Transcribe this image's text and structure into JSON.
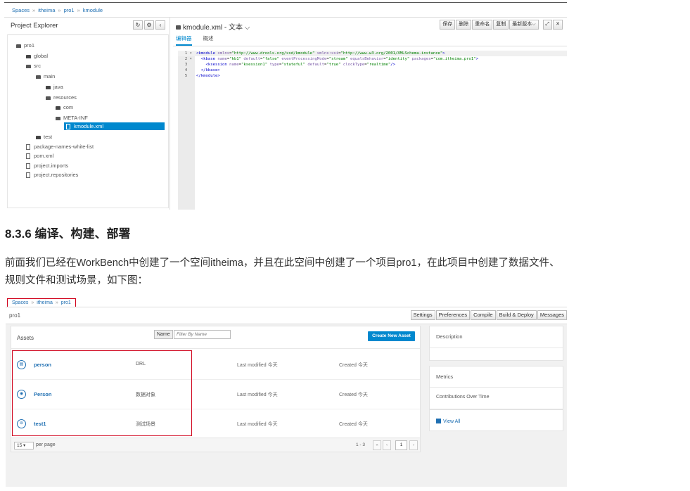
{
  "shot1": {
    "breadcrumb": [
      "Spaces",
      "itheima",
      "pro1",
      "kmodule"
    ],
    "explorer": {
      "title": "Project Explorer",
      "tree": [
        "pro1",
        "global",
        "src",
        "main",
        "java",
        "resources",
        "com",
        "META-INF",
        "kmodule.xml",
        "test",
        "package-names-white-list",
        "pom.xml",
        "project.imports",
        "project.repositories"
      ]
    },
    "editor": {
      "title": "kmodule.xml - 文本",
      "title_suffix": "⌵",
      "actions": [
        "保存",
        "删除",
        "重命名",
        "复制",
        "最新版本⌵"
      ],
      "tabs": [
        "编辑器",
        "概述"
      ],
      "code_lines": [
        {
          "num": "1",
          "fold": "▾",
          "text": "<kmodule xmlns=\"http://www.drools.org/xsd/kmodule\" xmlns:xsi=\"http://www.w3.org/2001/XMLSchema-instance\">"
        },
        {
          "num": "2",
          "fold": "▾",
          "text": "  <kbase name=\"kb1\" default=\"false\" eventProcessingMode=\"stream\" equalsBehavior=\"identity\" packages=\"com.itheima.pro1\">"
        },
        {
          "num": "3",
          "fold": "",
          "text": "    <ksession name=\"ksession1\" type=\"stateful\" default=\"true\" clockType=\"realtime\"/>"
        },
        {
          "num": "4",
          "fold": "",
          "text": "  </kbase>"
        },
        {
          "num": "5",
          "fold": "",
          "text": "</kmodule>"
        }
      ]
    }
  },
  "article": {
    "heading": "8.3.6 编译、构建、部署",
    "paragraph": "前面我们已经在WorkBench中创建了一个空间itheima，并且在此空间中创建了一个项目pro1，在此项目中创建了数据文件、规则文件和测试场景，如下图："
  },
  "shot2": {
    "breadcrumb": [
      "Spaces",
      "itheima",
      "pro1"
    ],
    "project_name": "pro1",
    "project_buttons": [
      "Settings",
      "Preferences",
      "Compile",
      "Build & Deploy",
      "Messages"
    ],
    "assets": {
      "title": "Assets",
      "filter_label": "Name",
      "filter_placeholder": "Filter By Name",
      "create_button": "Create New Asset",
      "rows": [
        {
          "icon": "drl",
          "name": "person",
          "type": "DRL",
          "modified": "Last modified 今天",
          "created": "Created 今天"
        },
        {
          "icon": "data",
          "name": "Person",
          "type": "数据对象",
          "modified": "Last modified 今天",
          "created": "Created 今天"
        },
        {
          "icon": "test",
          "name": "test1",
          "type": "测试场景",
          "modified": "Last modified 今天",
          "created": "Created 今天"
        }
      ],
      "per_page_value": "15",
      "per_page_label": "per page",
      "range": "1 - 3",
      "page": "1"
    },
    "side": {
      "description_title": "Description",
      "metrics_title": "Metrics",
      "contributions_title": "Contributions Over Time",
      "view_all": "View All"
    }
  },
  "colors": {
    "accent": "#0088ce",
    "link": "#1f6fb2",
    "highlight_border": "#d0021b"
  }
}
